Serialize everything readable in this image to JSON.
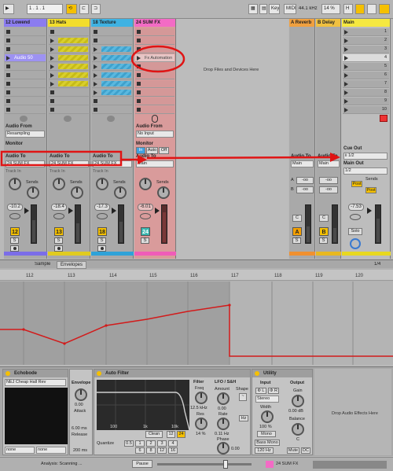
{
  "transport": {
    "bar_position": "1 . 1 . 1",
    "key": "Key",
    "midi": "MIDI",
    "sample_rate": "44.1 kHz",
    "cpu": "14 %"
  },
  "tracks": [
    {
      "name": "12 Lowend",
      "color": "#8b7cf0",
      "volume": "-10.2",
      "number": "12",
      "audio_from": "Resampling",
      "audio_to": "24 SUM FX",
      "clip_label": "Audio 50",
      "track_in": "Track In"
    },
    {
      "name": "13 Hats",
      "color": "#f2dd2c",
      "volume": "-18.4",
      "number": "13",
      "audio_to": "24 SUM FX",
      "track_in": "Track In"
    },
    {
      "name": "18 Texture",
      "color": "#3fb2e2",
      "volume": "-17.3",
      "number": "18",
      "audio_to": "24 SUM FX",
      "track_in": "Track In"
    },
    {
      "name": "24 SUM FX",
      "color": "#f36bc5",
      "volume": "-6.01",
      "number": "24",
      "audio_from": "No Input",
      "audio_to": "Main",
      "clip_label": "Fx Automation",
      "monitor_in": "In",
      "monitor_auto": "Auto",
      "monitor_off": "Off"
    }
  ],
  "returns": [
    {
      "name": "A Reverb",
      "color": "#f0a040",
      "letter": "A",
      "audio_to": "Main"
    },
    {
      "name": "B Delay",
      "color": "#f0c040",
      "letter": "B",
      "audio_to": "Main"
    }
  ],
  "main": {
    "name": "Main",
    "scenes": [
      "1",
      "2",
      "3",
      "4",
      "5",
      "6",
      "7",
      "8",
      "9",
      "10"
    ],
    "volume": "-7.53",
    "cue_out": "Cue Out",
    "cue_value": "ii 1/2",
    "main_out": "Main Out",
    "main_value": "1/2",
    "solo": "Solo",
    "post": "Post",
    "sends_label": "Sends"
  },
  "labels": {
    "audio_from": "Audio From",
    "monitor": "Monitor",
    "audio_to": "Audio To",
    "sends": "Sends",
    "drop_files": "Drop Files and Devices Here",
    "drop_audio_fx": "Drop Audio Effects Here",
    "s": "S",
    "c": "C",
    "a_to": "A  To",
    "b_to": "B  To",
    "return_a": "A",
    "return_b": "B",
    "send_value": "-oo"
  },
  "clip_view": {
    "tabs": [
      "Sample",
      "Envelopes"
    ],
    "page": "1/4",
    "ruler": [
      "112",
      "113",
      "114",
      "115",
      "116",
      "117",
      "118",
      "119",
      "120"
    ]
  },
  "devices": {
    "echobode": {
      "title": "Echobode",
      "preset": "NEJ Cheap Hall Rev",
      "envelope": "Envelope",
      "attack_value": "0.00",
      "attack": "Attack",
      "release_value": "6.00 ms",
      "release": "Release",
      "decay_value": "200 ms",
      "none1": "none",
      "none2": "none"
    },
    "auto_filter": {
      "title": "Auto Filter",
      "filter": "Filter",
      "freq": "Freq",
      "freq_value": "12.5 kHz",
      "res": "Res",
      "res_value": "14 %",
      "lfo": "LFO / S&H",
      "amount": "Amount",
      "amount_value": "0.00",
      "shape": "Shape",
      "rate": "Rate",
      "rate_value": "0.11 Hz",
      "phase": "Phase",
      "phase_value": "0.00",
      "quantize": "Quantize",
      "q_vals": [
        "0.5",
        "1",
        "2",
        "3",
        "4"
      ],
      "q_vals2": [
        "6",
        "8",
        "12",
        "16"
      ],
      "clean": "Clean",
      "x12": "12",
      "x24": "24",
      "hz": "Hz",
      "graph_ticks": [
        "100",
        "1k",
        "10k"
      ]
    },
    "utility": {
      "title": "Utility",
      "input": "Input",
      "output": "Output",
      "phi_l": "Φ L",
      "phi_r": "Φ R",
      "stereo": "Stereo",
      "width": "Width",
      "width_value": "100 %",
      "mono": "Mono",
      "bass_mono": "Bass Mono",
      "freq_120": "120 Hz",
      "gain": "Gain",
      "gain_value": "0.00 dB",
      "balance": "Balance",
      "balance_value": "C",
      "mute": "Mute",
      "dc": "DC"
    }
  },
  "status": {
    "analysis": "Analysis: Scanning ...",
    "pause": "Pause",
    "track": "24 SUM FX"
  }
}
